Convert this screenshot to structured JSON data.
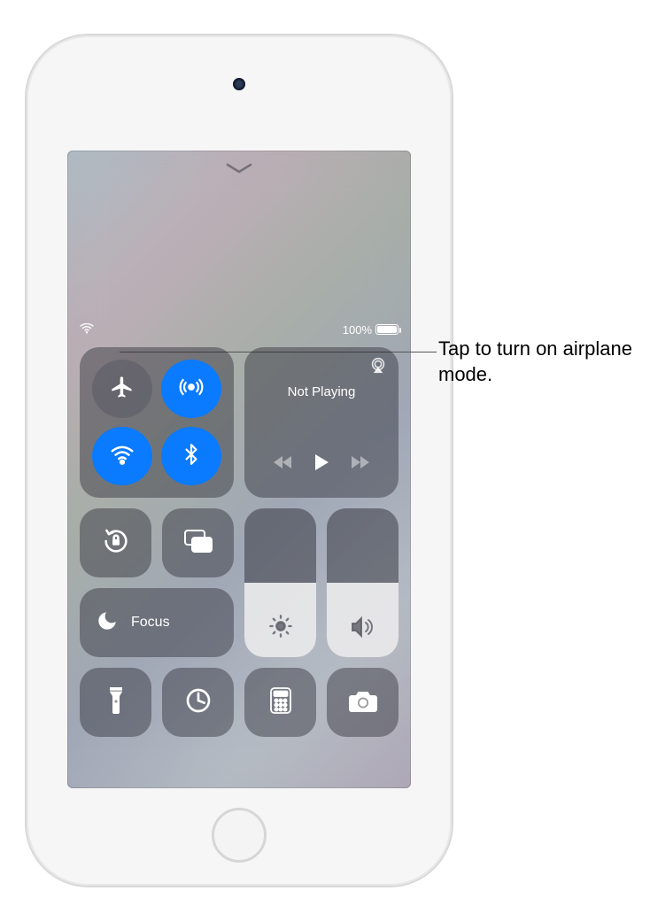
{
  "status": {
    "battery_text": "100%",
    "battery_level": 100
  },
  "connectivity": {
    "airplane": {
      "on": false
    },
    "airdrop": {
      "on": true
    },
    "wifi": {
      "on": true
    },
    "bluetooth": {
      "on": true
    }
  },
  "media": {
    "title": "Not Playing"
  },
  "focus": {
    "label": "Focus"
  },
  "sliders": {
    "brightness": {
      "value": 50
    },
    "volume": {
      "value": 50
    }
  },
  "callout": {
    "text": "Tap to turn on airplane mode."
  }
}
